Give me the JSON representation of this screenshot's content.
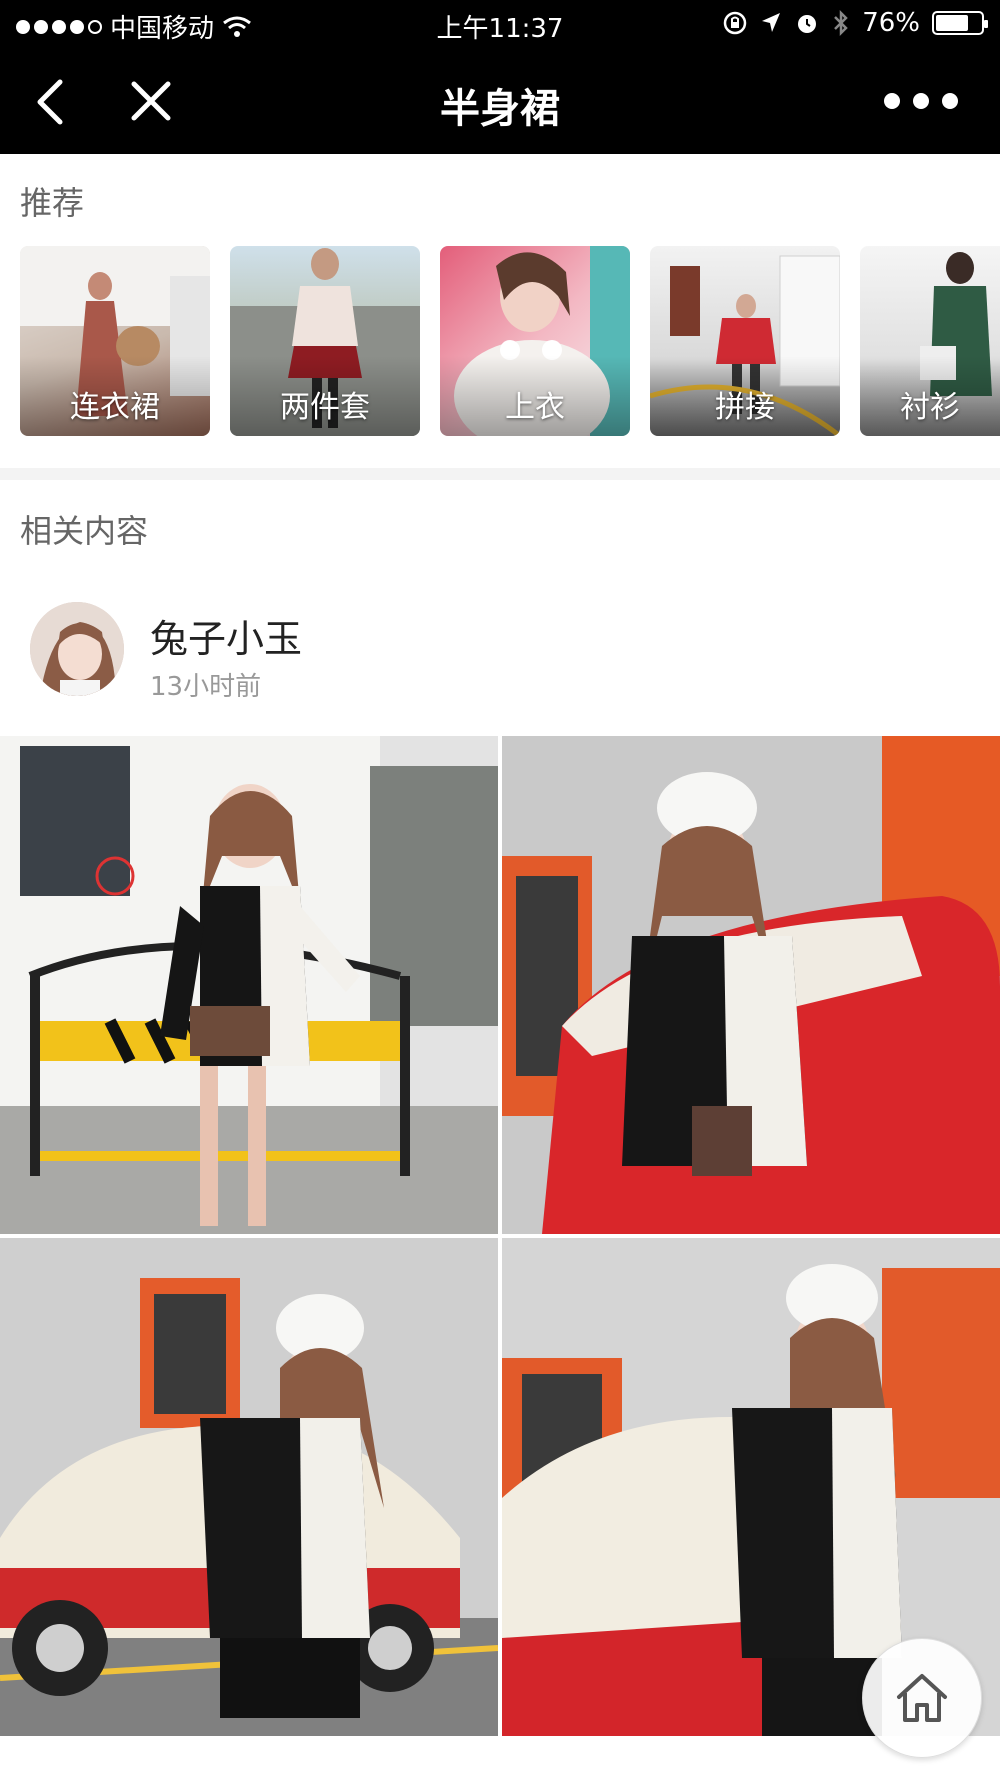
{
  "status_bar": {
    "carrier": "中国移动",
    "time": "上午11:37",
    "battery": "76%",
    "battery_level": 0.76,
    "icons": [
      "signal-dots",
      "wifi-icon",
      "rotation-lock-icon",
      "location-icon",
      "alarm-icon",
      "bluetooth-icon",
      "battery-icon"
    ]
  },
  "nav": {
    "title": "半身裙",
    "icons": [
      "back-icon",
      "close-icon",
      "more-icon"
    ]
  },
  "recommend": {
    "title": "推荐",
    "items": [
      {
        "label": "连衣裙"
      },
      {
        "label": "两件套"
      },
      {
        "label": "上衣"
      },
      {
        "label": "拼接"
      },
      {
        "label": "衬衫"
      }
    ]
  },
  "related": {
    "title": "相关内容"
  },
  "post": {
    "author": "兔子小玉",
    "time": "13小时前",
    "photos": [
      {
        "alt": "photo-1"
      },
      {
        "alt": "photo-2"
      },
      {
        "alt": "photo-3"
      },
      {
        "alt": "photo-4"
      }
    ]
  },
  "home_button": {
    "icon": "home-icon"
  }
}
